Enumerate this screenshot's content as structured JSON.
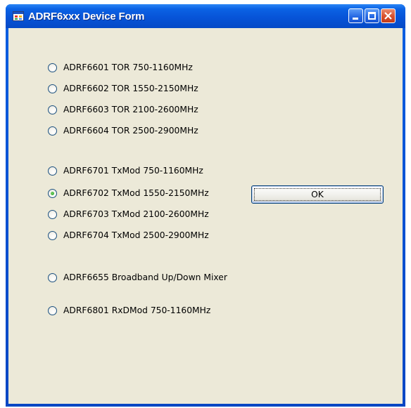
{
  "window": {
    "title": "ADRF6xxx Device Form",
    "title_bar_color": "#0854d6",
    "client_background": "#ece9d8",
    "controls": {
      "minimize": "minimize-icon",
      "maximize": "maximize-icon",
      "close": "close-icon"
    }
  },
  "radio_options": [
    {
      "label": "ADRF6601 TOR 750-1160MHz",
      "selected": false
    },
    {
      "label": "ADRF6602 TOR 1550-2150MHz",
      "selected": false
    },
    {
      "label": "ADRF6603 TOR 2100-2600MHz",
      "selected": false
    },
    {
      "label": "ADRF6604 TOR 2500-2900MHz",
      "selected": false
    },
    {
      "label": "ADRF6701 TxMod 750-1160MHz",
      "selected": false
    },
    {
      "label": "ADRF6702 TxMod 1550-2150MHz",
      "selected": true
    },
    {
      "label": "ADRF6703 TxMod 2100-2600MHz",
      "selected": false
    },
    {
      "label": "ADRF6704 TxMod 2500-2900MHz",
      "selected": false
    },
    {
      "label": "ADRF6655 Broadband Up/Down Mixer",
      "selected": false
    },
    {
      "label": "ADRF6801 RxDMod 750-1160MHz",
      "selected": false
    }
  ],
  "ok_button": {
    "label": "OK"
  }
}
